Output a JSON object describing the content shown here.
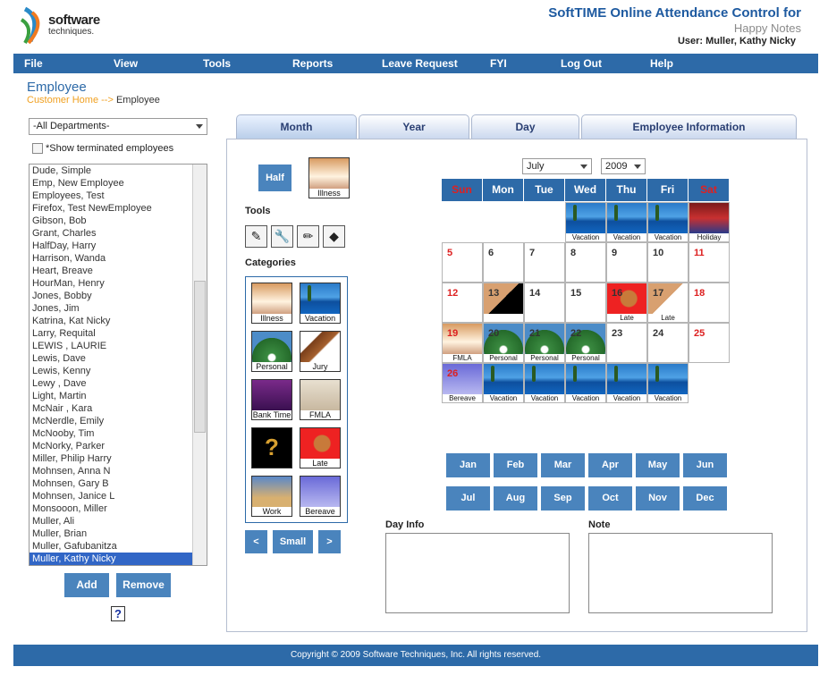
{
  "header": {
    "logo_text": "software",
    "logo_text2": "techniques.",
    "app_title": "SoftTIME Online Attendance Control for",
    "company": "Happy Notes",
    "user_line": "User: Muller, Kathy Nicky"
  },
  "menu": [
    "File",
    "View",
    "Tools",
    "Reports",
    "Leave Request",
    "FYI",
    "Log Out",
    "Help"
  ],
  "page_title": "Employee",
  "breadcrumb": {
    "link": "Customer Home -->",
    "current": "Employee"
  },
  "left": {
    "department": "-All Departments-",
    "show_terminated": "*Show terminated employees",
    "employees": [
      "Dude, Simple",
      "Emp, New Employee",
      "Employees, Test",
      "Firefox, Test NewEmployee",
      "Gibson, Bob",
      "Grant, Charles",
      "HalfDay, Harry",
      "Harrison, Wanda",
      "Heart, Breave",
      "HourMan, Henry",
      "Jones, Bobby",
      "Jones, Jim",
      "Katrina, Kat Nicky",
      "Larry, Requital",
      "LEWIS , LAURIE",
      "Lewis, Dave",
      "Lewis, Kenny",
      "Lewy , Dave",
      "Light, Martin",
      "McNair , Kara",
      "McNerdle, Emily",
      "McNooby, Tim",
      "McNorky, Parker",
      "Miller, Philip Harry",
      "Mohnsen, Anna N",
      "Mohnsen, Gary B",
      "Mohnsen, Janice L",
      "Monsooon, Miller",
      "Muller, Ali",
      "Muller, Brian",
      "Muller, Gafubanitza",
      "Muller, Kathy Nicky"
    ],
    "selected": "Muller, Kathy Nicky",
    "add_label": "Add",
    "remove_label": "Remove",
    "help_glyph": "?"
  },
  "tabs": [
    "Month",
    "Year",
    "Day",
    "Employee Information"
  ],
  "active_tab": "Month",
  "tools_panel": {
    "half_label": "Half",
    "current_category": "Illness",
    "tools_label": "Tools",
    "tool_icons": [
      "pencil-icon",
      "wrench-icon",
      "pen-icon",
      "warning-icon"
    ],
    "categories_label": "Categories",
    "categories": [
      "Illness",
      "Vacation",
      "Personal",
      "Jury",
      "Bank Time",
      "FMLA",
      "",
      "Late",
      "Work",
      "Bereave"
    ],
    "prev_label": "<",
    "small_label": "Small",
    "next_label": ">"
  },
  "calendar": {
    "month": "July",
    "year": "2009",
    "day_headers": [
      "Sun",
      "Mon",
      "Tue",
      "Wed",
      "Thu",
      "Fri",
      "Sat"
    ],
    "cells": [
      {
        "n": "",
        "cat": ""
      },
      {
        "n": "",
        "cat": ""
      },
      {
        "n": "",
        "cat": ""
      },
      {
        "n": "",
        "cat": "Vacation"
      },
      {
        "n": "",
        "cat": "Vacation"
      },
      {
        "n": "",
        "cat": "Vacation"
      },
      {
        "n": "",
        "cat": "Holiday"
      },
      {
        "n": "5",
        "cat": ""
      },
      {
        "n": "6",
        "cat": ""
      },
      {
        "n": "7",
        "cat": ""
      },
      {
        "n": "8",
        "cat": ""
      },
      {
        "n": "9",
        "cat": ""
      },
      {
        "n": "10",
        "cat": ""
      },
      {
        "n": "11",
        "cat": ""
      },
      {
        "n": "12",
        "cat": ""
      },
      {
        "n": "13",
        "cat": "split"
      },
      {
        "n": "14",
        "cat": ""
      },
      {
        "n": "15",
        "cat": ""
      },
      {
        "n": "16",
        "cat": "Late"
      },
      {
        "n": "17",
        "cat": "Late-half"
      },
      {
        "n": "18",
        "cat": ""
      },
      {
        "n": "19",
        "cat": "FMLA"
      },
      {
        "n": "20",
        "cat": "Personal"
      },
      {
        "n": "21",
        "cat": "Personal"
      },
      {
        "n": "22",
        "cat": "Personal"
      },
      {
        "n": "23",
        "cat": ""
      },
      {
        "n": "24",
        "cat": ""
      },
      {
        "n": "25",
        "cat": ""
      },
      {
        "n": "26",
        "cat": "Bereave"
      },
      {
        "n": "",
        "cat": "Vacation"
      },
      {
        "n": "",
        "cat": "Vacation"
      },
      {
        "n": "",
        "cat": "Vacation"
      },
      {
        "n": "",
        "cat": "Vacation"
      },
      {
        "n": "",
        "cat": "Vacation"
      }
    ]
  },
  "months": [
    "Jan",
    "Feb",
    "Mar",
    "Apr",
    "May",
    "Jun",
    "Jul",
    "Aug",
    "Sep",
    "Oct",
    "Nov",
    "Dec"
  ],
  "day_info_label": "Day Info",
  "note_label": "Note",
  "footer": "Copyright © 2009 Software Techniques, Inc. All rights reserved."
}
